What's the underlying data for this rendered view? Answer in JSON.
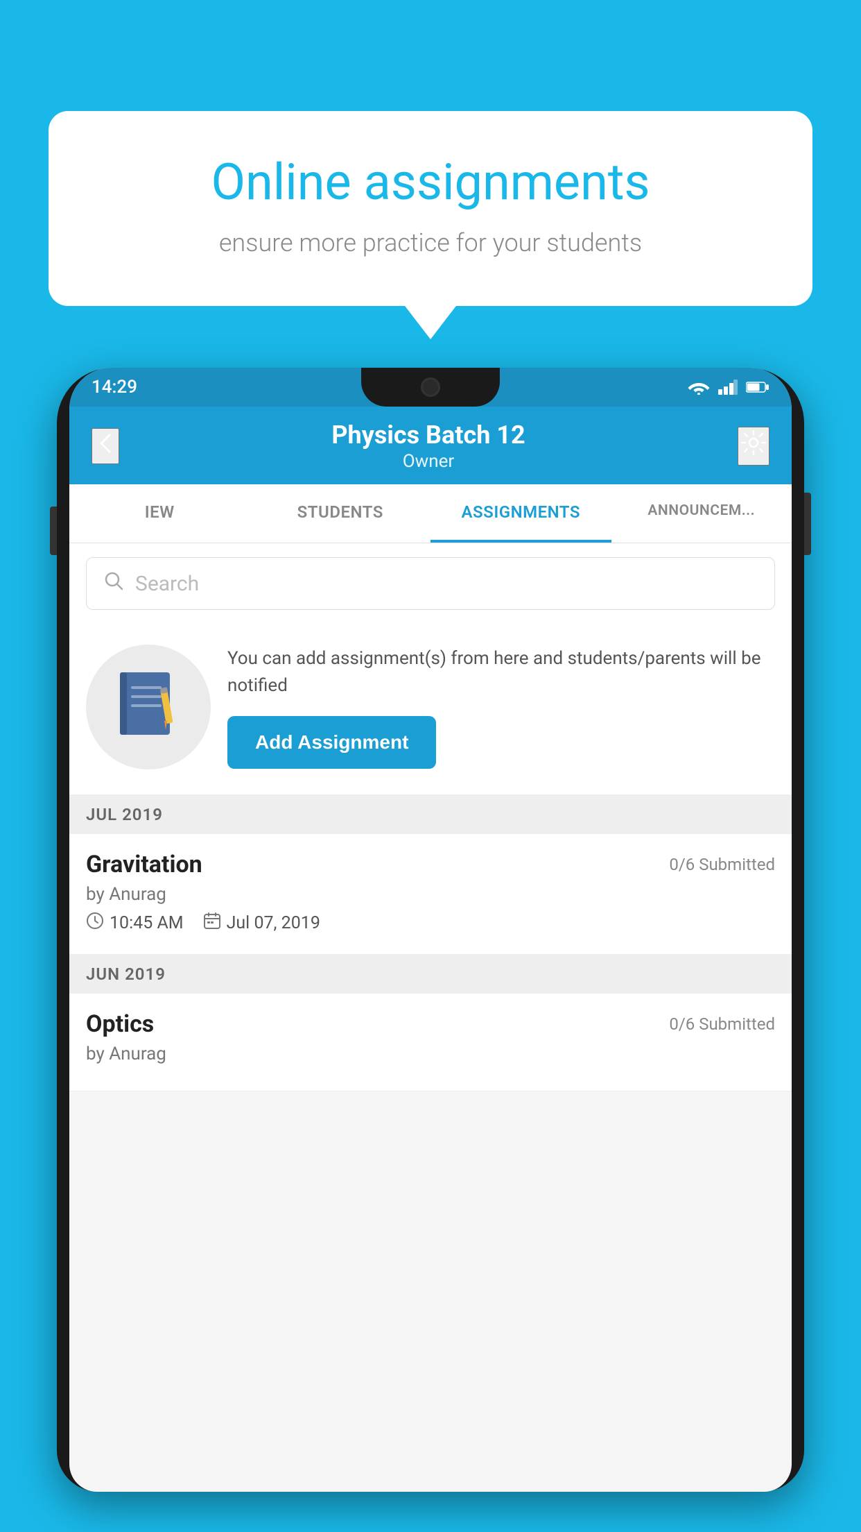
{
  "background_color": "#1ab8e8",
  "speech_bubble": {
    "title": "Online assignments",
    "subtitle": "ensure more practice for your students"
  },
  "status_bar": {
    "time": "14:29",
    "wifi": "wifi",
    "signal": "signal",
    "battery": "battery"
  },
  "header": {
    "back_label": "←",
    "title": "Physics Batch 12",
    "subtitle": "Owner",
    "settings_label": "⚙"
  },
  "tabs": [
    {
      "label": "IEW",
      "active": false
    },
    {
      "label": "STUDENTS",
      "active": false
    },
    {
      "label": "ASSIGNMENTS",
      "active": true
    },
    {
      "label": "ANNOUNCEM...",
      "active": false
    }
  ],
  "search": {
    "placeholder": "Search"
  },
  "promo": {
    "text": "You can add assignment(s) from here and students/parents will be notified",
    "button_label": "Add Assignment"
  },
  "sections": [
    {
      "header": "JUL 2019",
      "assignments": [
        {
          "name": "Gravitation",
          "submitted": "0/6 Submitted",
          "by": "by Anurag",
          "time": "10:45 AM",
          "date": "Jul 07, 2019"
        }
      ]
    },
    {
      "header": "JUN 2019",
      "assignments": [
        {
          "name": "Optics",
          "submitted": "0/6 Submitted",
          "by": "by Anurag",
          "time": "",
          "date": ""
        }
      ]
    }
  ]
}
